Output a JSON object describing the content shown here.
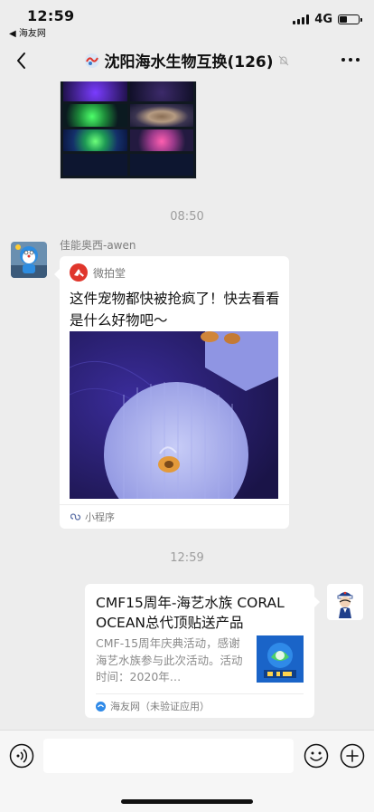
{
  "status_bar": {
    "time": "12:59",
    "back_app": "◀ 海友网",
    "network": "4G",
    "battery_level": 0.4
  },
  "nav": {
    "title": "沈阳海水生物互换(126)",
    "icons": {
      "back": "chevron-left-icon",
      "title": "group-avatar-icon",
      "mute": "mute-bell-icon",
      "more": "more-dots-icon"
    }
  },
  "messages": {
    "time_1": "08:50",
    "sender_name": "佳能奥西-awen",
    "mini_program": {
      "app_name": "微拍堂",
      "text": "这件宠物都快被抢疯了！快去看看是什么好物吧～",
      "footer_label": "小程序"
    },
    "time_2": "12:59",
    "link_card": {
      "title": "CMF15周年-海艺水族 CORAL OCEAN总代顶贴送产品",
      "description": "CMF-15周年庆典活动，感谢海艺水族参与此次活动。活动时间：2020年…",
      "source": "海友网（未验证应用）"
    }
  },
  "input_bar": {
    "placeholder": "",
    "icons": {
      "voice": "voice-icon",
      "emoji": "emoji-icon",
      "plus": "plus-icon"
    }
  },
  "colors": {
    "background": "#ededed",
    "bubble": "#ffffff",
    "muted_text": "#9d9d9d",
    "accent_red": "#e0362c"
  }
}
